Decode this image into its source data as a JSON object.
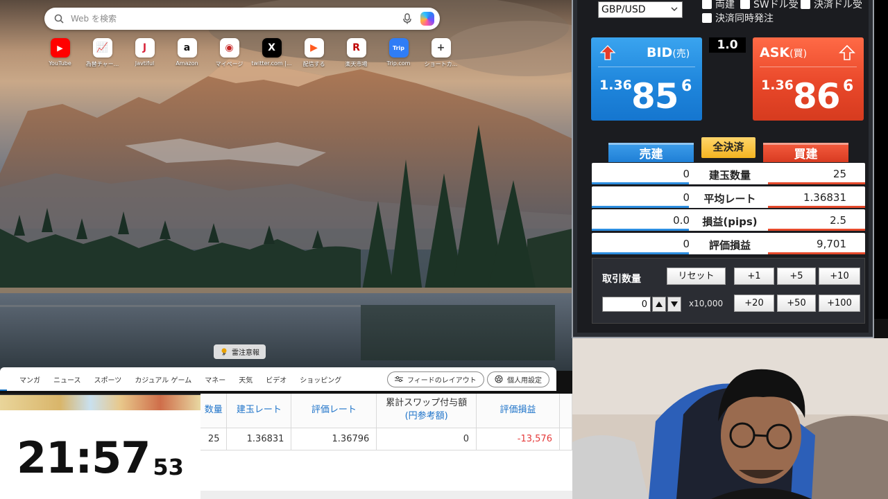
{
  "browser": {
    "search": {
      "placeholder": "Web を検索"
    },
    "quicklinks": [
      {
        "label": "YouTube",
        "icon": "youtube-icon",
        "glyph": "▶",
        "color": "#ff0000"
      },
      {
        "label": "為替チャー...",
        "icon": "chart-icon",
        "glyph": "📈",
        "color": "#d7263d"
      },
      {
        "label": "Javtiful",
        "icon": "javtiful-icon",
        "glyph": "J",
        "color": "#d9263c"
      },
      {
        "label": "Amazon",
        "icon": "amazon-icon",
        "glyph": "a",
        "color": "#111111"
      },
      {
        "label": "マイページ",
        "icon": "mypage-icon",
        "glyph": "◉",
        "color": "#c62828"
      },
      {
        "label": "twitter.com |...",
        "icon": "x-icon",
        "glyph": "X",
        "color": "#000000"
      },
      {
        "label": "配信する",
        "icon": "broadcast-icon",
        "glyph": "▶",
        "color": "#ff5a1f"
      },
      {
        "label": "楽天市場",
        "icon": "rakuten-icon",
        "glyph": "R",
        "color": "#bf0000"
      },
      {
        "label": "Trip.com",
        "icon": "trip-icon",
        "glyph": "Trip",
        "color": "#2f7df6"
      },
      {
        "label": "ショートカ...",
        "icon": "add-shortcut-icon",
        "glyph": "+",
        "color": "#333333"
      }
    ],
    "weather_chip": "雷注意報",
    "feed_nav": {
      "categories": [
        "マンガ",
        "ニュース",
        "スポーツ",
        "カジュアル ゲーム",
        "マネー",
        "天気",
        "ビデオ",
        "ショッピング"
      ],
      "layout_button": "フィードのレイアウト",
      "personal_button": "個人用設定"
    }
  },
  "positions_table": {
    "headers": [
      "数量",
      "建玉レート",
      "評価レート",
      "累計スワップ付与額",
      "(円参考額)",
      "評価損益"
    ],
    "row": [
      "25",
      "1.36831",
      "1.36796",
      "0",
      "-13,576"
    ]
  },
  "clock": {
    "hm": "21:57",
    "sec": "53"
  },
  "fx_panel": {
    "pair": "GBP/USD",
    "options": [
      "両建",
      "SWドル受",
      "決済ドル受",
      "決済同時発注"
    ],
    "spread": "1.0",
    "bid": {
      "label": "BID",
      "sub": "(売)",
      "prefix": "1.36",
      "big": "85",
      "pip": "6"
    },
    "ask": {
      "label": "ASK",
      "sub": "(買)",
      "prefix": "1.36",
      "big": "86",
      "pip": "6"
    },
    "sell_label": "売建",
    "close_all_label": "全決済",
    "buy_label": "買建",
    "stats": [
      {
        "left": "0",
        "label": "建玉数量",
        "right": "25"
      },
      {
        "left": "0",
        "label": "平均レート",
        "right": "1.36831"
      },
      {
        "left": "0.0",
        "label": "損益(pips)",
        "right": "2.5"
      },
      {
        "left": "0",
        "label": "評価損益",
        "right": "9,701"
      }
    ],
    "qty": {
      "label": "取引数量",
      "reset": "リセット",
      "value": "0",
      "unit": "x10,000",
      "increments": [
        "+1",
        "+5",
        "+10",
        "+20",
        "+50",
        "+100"
      ]
    }
  },
  "colors": {
    "bid": "#1f86dc",
    "ask": "#e9482a",
    "close_all": "#f4b421",
    "loss": "#e53b3b",
    "link": "#1e73c9"
  }
}
